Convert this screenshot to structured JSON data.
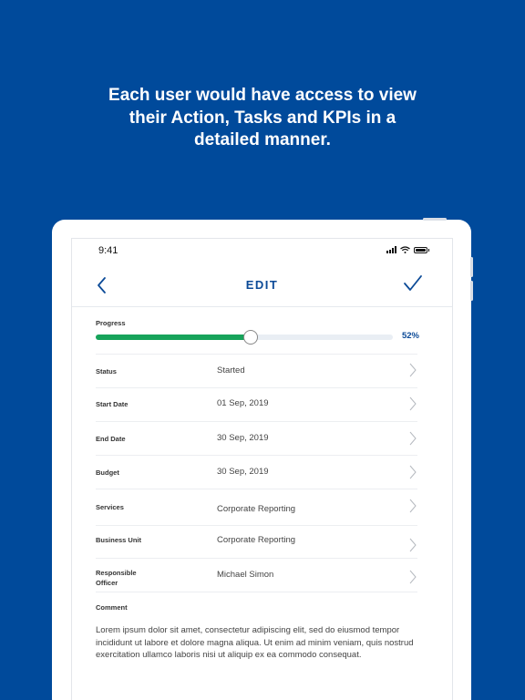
{
  "headline": {
    "line1": "Each user would have access to view",
    "line2": "their Action, Tasks and KPIs in a",
    "line3": "detailed manner."
  },
  "status_bar": {
    "time": "9:41"
  },
  "nav": {
    "title": "EDIT",
    "back_icon": "chevron-left-icon",
    "confirm_icon": "checkmark-icon"
  },
  "progress": {
    "label": "Progress",
    "value_percent": 52,
    "value_text": "52%"
  },
  "fields": [
    {
      "label": "Status",
      "value": "Started"
    },
    {
      "label": "Start Date",
      "value": "01 Sep, 2019"
    },
    {
      "label": "End Date",
      "value": "30 Sep, 2019"
    },
    {
      "label": "Budget",
      "value": "30 Sep, 2019"
    },
    {
      "label": "Services",
      "value": "Corporate Reporting"
    },
    {
      "label": "Business Unit",
      "value": "Corporate Reporting"
    },
    {
      "label_line1": "Responsible",
      "label_line2": "Officer",
      "value": "Michael Simon"
    }
  ],
  "comment": {
    "label": "Comment",
    "text": "Lorem ipsum dolor sit amet, consectetur adipiscing elit, sed do eiusmod tempor incididunt ut labore et dolore magna aliqua. Ut enim ad minim veniam, quis nostrud exercitation ullamco laboris nisi ut aliquip ex ea commodo consequat."
  },
  "colors": {
    "background": "#004a9b",
    "accent": "#0b4a97",
    "progress": "#17a35a"
  }
}
